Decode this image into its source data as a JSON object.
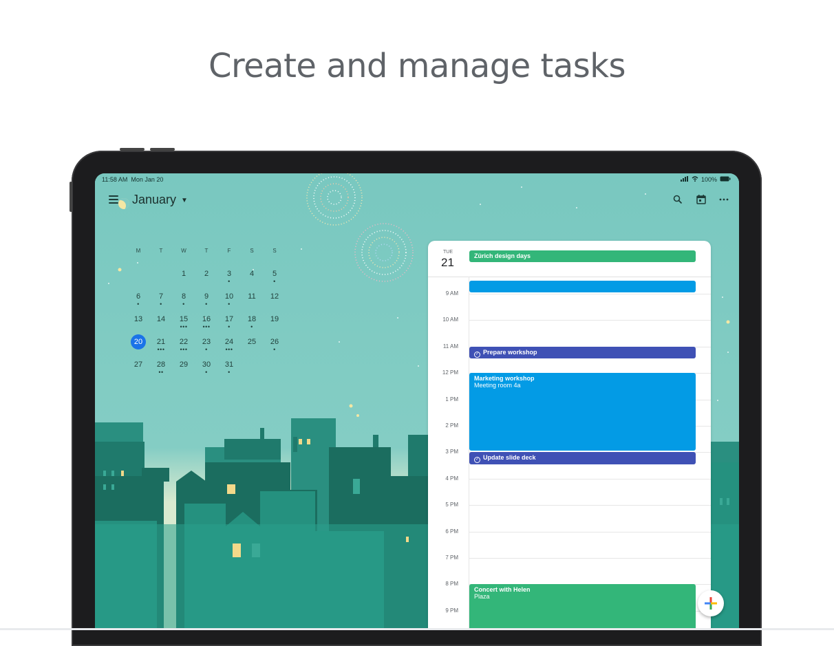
{
  "headline": "Create and manage tasks",
  "status_bar": {
    "time": "11:58 AM",
    "date": "Mon Jan 20",
    "battery": "100%"
  },
  "app_bar": {
    "month": "January",
    "icons": [
      "menu-icon",
      "search-icon",
      "calendar-today-icon",
      "more-icon"
    ]
  },
  "mini_calendar": {
    "weekdays": [
      "M",
      "T",
      "W",
      "T",
      "F",
      "S",
      "S"
    ],
    "weeks": [
      [
        null,
        null,
        {
          "d": "1"
        },
        {
          "d": "2"
        },
        {
          "d": "3",
          "dots": "•"
        },
        {
          "d": "4"
        },
        {
          "d": "5",
          "dots": "•"
        }
      ],
      [
        {
          "d": "6",
          "dots": "•"
        },
        {
          "d": "7",
          "dots": "•"
        },
        {
          "d": "8",
          "dots": "•"
        },
        {
          "d": "9",
          "dots": "•"
        },
        {
          "d": "10",
          "dots": "•"
        },
        {
          "d": "11"
        },
        {
          "d": "12"
        }
      ],
      [
        {
          "d": "13"
        },
        {
          "d": "14"
        },
        {
          "d": "15",
          "dots": "•••"
        },
        {
          "d": "16",
          "dots": "•••"
        },
        {
          "d": "17",
          "dots": "•"
        },
        {
          "d": "18",
          "dots": "•"
        },
        {
          "d": "19"
        }
      ],
      [
        {
          "d": "20",
          "today": true
        },
        {
          "d": "21",
          "dots": "•••"
        },
        {
          "d": "22",
          "dots": "•••"
        },
        {
          "d": "23",
          "dots": "•"
        },
        {
          "d": "24",
          "dots": "•••"
        },
        {
          "d": "25"
        },
        {
          "d": "26",
          "dots": "•"
        }
      ],
      [
        {
          "d": "27"
        },
        {
          "d": "28",
          "dots": "••"
        },
        {
          "d": "29"
        },
        {
          "d": "30",
          "dots": "•"
        },
        {
          "d": "31",
          "dots": "•"
        },
        null,
        null
      ]
    ]
  },
  "day_view": {
    "weekday": "TUE",
    "date": "21",
    "all_day_event": "Zürich design days",
    "hours": [
      "9 AM",
      "10 AM",
      "11 AM",
      "12 PM",
      "1 PM",
      "2 PM",
      "3 PM",
      "4 PM",
      "5 PM",
      "6 PM",
      "7 PM",
      "8 PM",
      "9 PM"
    ],
    "events": [
      {
        "title": "",
        "subtitle": "",
        "color": "#039be5",
        "task": false,
        "start": 8.5,
        "end": 9.0
      },
      {
        "title": "Prepare workshop",
        "subtitle": "",
        "color": "#3f51b5",
        "task": true,
        "start": 11.0,
        "end": 11.5
      },
      {
        "title": "Marketing workshop",
        "subtitle": "Meeting room 4a",
        "color": "#039be5",
        "task": false,
        "start": 12.0,
        "end": 15.0
      },
      {
        "title": "Update slide deck",
        "subtitle": "",
        "color": "#3f51b5",
        "task": true,
        "start": 15.0,
        "end": 15.5
      },
      {
        "title": "Concert with Helen",
        "subtitle": "Plaza",
        "color": "#33b679",
        "task": false,
        "start": 20.0,
        "end": 22.0
      }
    ]
  },
  "fab": {
    "icon": "plus-icon"
  }
}
